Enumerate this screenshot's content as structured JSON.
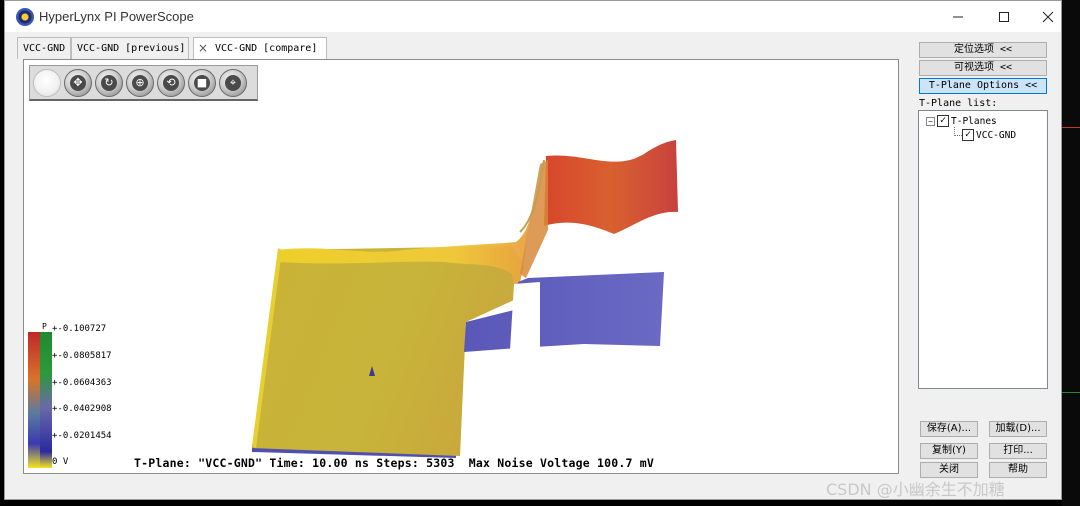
{
  "window": {
    "title": "HyperLynx PI PowerScope"
  },
  "tabs": [
    {
      "label": "VCC-GND"
    },
    {
      "label": "VCC-GND [previous]"
    },
    {
      "label": "VCC-GND [compare]",
      "close": "×"
    }
  ],
  "toolbar": {
    "buttons": [
      "blank-icon",
      "pan-icon",
      "rotate-icon",
      "zoom-icon",
      "reset-view-icon",
      "stop-icon",
      "fit-icon"
    ]
  },
  "legend": {
    "p_label": "P",
    "ticks": [
      "+-0.100727",
      "+-0.0805817",
      "+-0.0604363",
      "+-0.0402908",
      "+-0.0201454",
      "0 V"
    ],
    "colors": {
      "high": "#c0392b",
      "low": "#1a1aa8",
      "mid": "#f2d324",
      "green": "#1f8a2e"
    }
  },
  "status": {
    "text": "T-Plane: \"VCC-GND\" Time: 10.00 ns Steps: 5303  Max Noise Voltage 100.7 mV"
  },
  "right_panel": {
    "position_options": "定位选项 <<",
    "visual_options": "可视选项 <<",
    "tplane_options": "T-Plane Options <<",
    "tplane_list_label": "T-Plane list:",
    "tree": {
      "root_expander": "−",
      "root_label": "T-Planes",
      "child_label": "VCC-GND"
    }
  },
  "bottom_buttons": {
    "save": "保存(A)...",
    "load": "加载(D)...",
    "copy": "复制(Y)",
    "print": "打印...",
    "close": "关闭",
    "help": "帮助"
  },
  "watermark": "CSDN @小幽余生不加糖"
}
